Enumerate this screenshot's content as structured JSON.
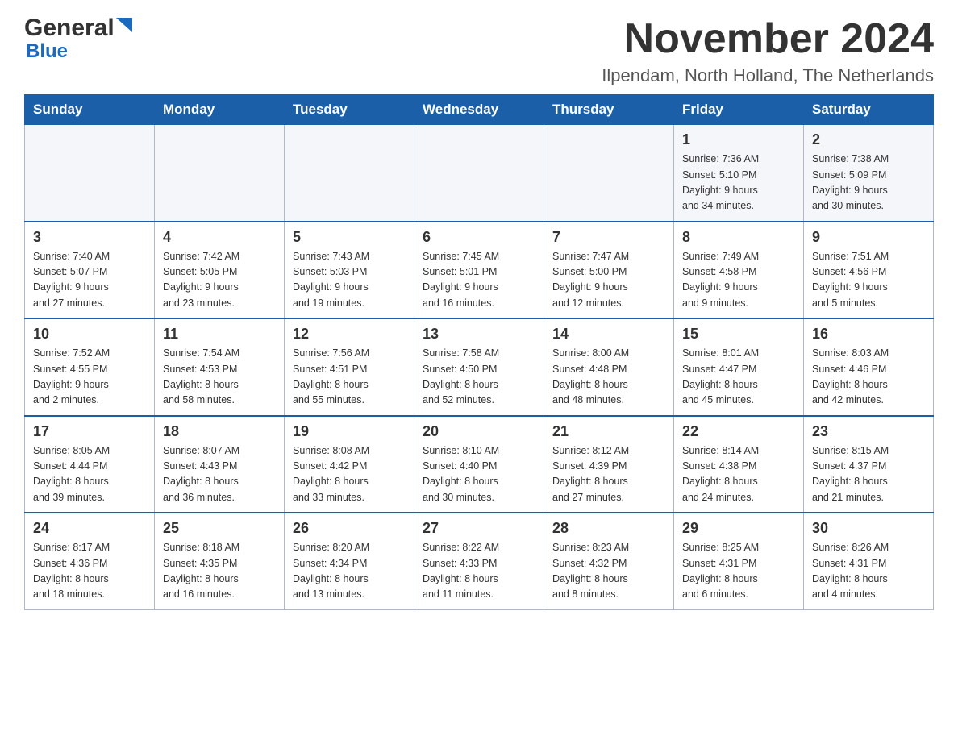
{
  "logo": {
    "general": "General",
    "blue": "Blue",
    "arrow_color": "#1a6bbf"
  },
  "header": {
    "month_title": "November 2024",
    "location": "Ilpendam, North Holland, The Netherlands"
  },
  "weekdays": [
    "Sunday",
    "Monday",
    "Tuesday",
    "Wednesday",
    "Thursday",
    "Friday",
    "Saturday"
  ],
  "weeks": [
    {
      "days": [
        {
          "number": "",
          "info": ""
        },
        {
          "number": "",
          "info": ""
        },
        {
          "number": "",
          "info": ""
        },
        {
          "number": "",
          "info": ""
        },
        {
          "number": "",
          "info": ""
        },
        {
          "number": "1",
          "info": "Sunrise: 7:36 AM\nSunset: 5:10 PM\nDaylight: 9 hours\nand 34 minutes."
        },
        {
          "number": "2",
          "info": "Sunrise: 7:38 AM\nSunset: 5:09 PM\nDaylight: 9 hours\nand 30 minutes."
        }
      ]
    },
    {
      "days": [
        {
          "number": "3",
          "info": "Sunrise: 7:40 AM\nSunset: 5:07 PM\nDaylight: 9 hours\nand 27 minutes."
        },
        {
          "number": "4",
          "info": "Sunrise: 7:42 AM\nSunset: 5:05 PM\nDaylight: 9 hours\nand 23 minutes."
        },
        {
          "number": "5",
          "info": "Sunrise: 7:43 AM\nSunset: 5:03 PM\nDaylight: 9 hours\nand 19 minutes."
        },
        {
          "number": "6",
          "info": "Sunrise: 7:45 AM\nSunset: 5:01 PM\nDaylight: 9 hours\nand 16 minutes."
        },
        {
          "number": "7",
          "info": "Sunrise: 7:47 AM\nSunset: 5:00 PM\nDaylight: 9 hours\nand 12 minutes."
        },
        {
          "number": "8",
          "info": "Sunrise: 7:49 AM\nSunset: 4:58 PM\nDaylight: 9 hours\nand 9 minutes."
        },
        {
          "number": "9",
          "info": "Sunrise: 7:51 AM\nSunset: 4:56 PM\nDaylight: 9 hours\nand 5 minutes."
        }
      ]
    },
    {
      "days": [
        {
          "number": "10",
          "info": "Sunrise: 7:52 AM\nSunset: 4:55 PM\nDaylight: 9 hours\nand 2 minutes."
        },
        {
          "number": "11",
          "info": "Sunrise: 7:54 AM\nSunset: 4:53 PM\nDaylight: 8 hours\nand 58 minutes."
        },
        {
          "number": "12",
          "info": "Sunrise: 7:56 AM\nSunset: 4:51 PM\nDaylight: 8 hours\nand 55 minutes."
        },
        {
          "number": "13",
          "info": "Sunrise: 7:58 AM\nSunset: 4:50 PM\nDaylight: 8 hours\nand 52 minutes."
        },
        {
          "number": "14",
          "info": "Sunrise: 8:00 AM\nSunset: 4:48 PM\nDaylight: 8 hours\nand 48 minutes."
        },
        {
          "number": "15",
          "info": "Sunrise: 8:01 AM\nSunset: 4:47 PM\nDaylight: 8 hours\nand 45 minutes."
        },
        {
          "number": "16",
          "info": "Sunrise: 8:03 AM\nSunset: 4:46 PM\nDaylight: 8 hours\nand 42 minutes."
        }
      ]
    },
    {
      "days": [
        {
          "number": "17",
          "info": "Sunrise: 8:05 AM\nSunset: 4:44 PM\nDaylight: 8 hours\nand 39 minutes."
        },
        {
          "number": "18",
          "info": "Sunrise: 8:07 AM\nSunset: 4:43 PM\nDaylight: 8 hours\nand 36 minutes."
        },
        {
          "number": "19",
          "info": "Sunrise: 8:08 AM\nSunset: 4:42 PM\nDaylight: 8 hours\nand 33 minutes."
        },
        {
          "number": "20",
          "info": "Sunrise: 8:10 AM\nSunset: 4:40 PM\nDaylight: 8 hours\nand 30 minutes."
        },
        {
          "number": "21",
          "info": "Sunrise: 8:12 AM\nSunset: 4:39 PM\nDaylight: 8 hours\nand 27 minutes."
        },
        {
          "number": "22",
          "info": "Sunrise: 8:14 AM\nSunset: 4:38 PM\nDaylight: 8 hours\nand 24 minutes."
        },
        {
          "number": "23",
          "info": "Sunrise: 8:15 AM\nSunset: 4:37 PM\nDaylight: 8 hours\nand 21 minutes."
        }
      ]
    },
    {
      "days": [
        {
          "number": "24",
          "info": "Sunrise: 8:17 AM\nSunset: 4:36 PM\nDaylight: 8 hours\nand 18 minutes."
        },
        {
          "number": "25",
          "info": "Sunrise: 8:18 AM\nSunset: 4:35 PM\nDaylight: 8 hours\nand 16 minutes."
        },
        {
          "number": "26",
          "info": "Sunrise: 8:20 AM\nSunset: 4:34 PM\nDaylight: 8 hours\nand 13 minutes."
        },
        {
          "number": "27",
          "info": "Sunrise: 8:22 AM\nSunset: 4:33 PM\nDaylight: 8 hours\nand 11 minutes."
        },
        {
          "number": "28",
          "info": "Sunrise: 8:23 AM\nSunset: 4:32 PM\nDaylight: 8 hours\nand 8 minutes."
        },
        {
          "number": "29",
          "info": "Sunrise: 8:25 AM\nSunset: 4:31 PM\nDaylight: 8 hours\nand 6 minutes."
        },
        {
          "number": "30",
          "info": "Sunrise: 8:26 AM\nSunset: 4:31 PM\nDaylight: 8 hours\nand 4 minutes."
        }
      ]
    }
  ]
}
